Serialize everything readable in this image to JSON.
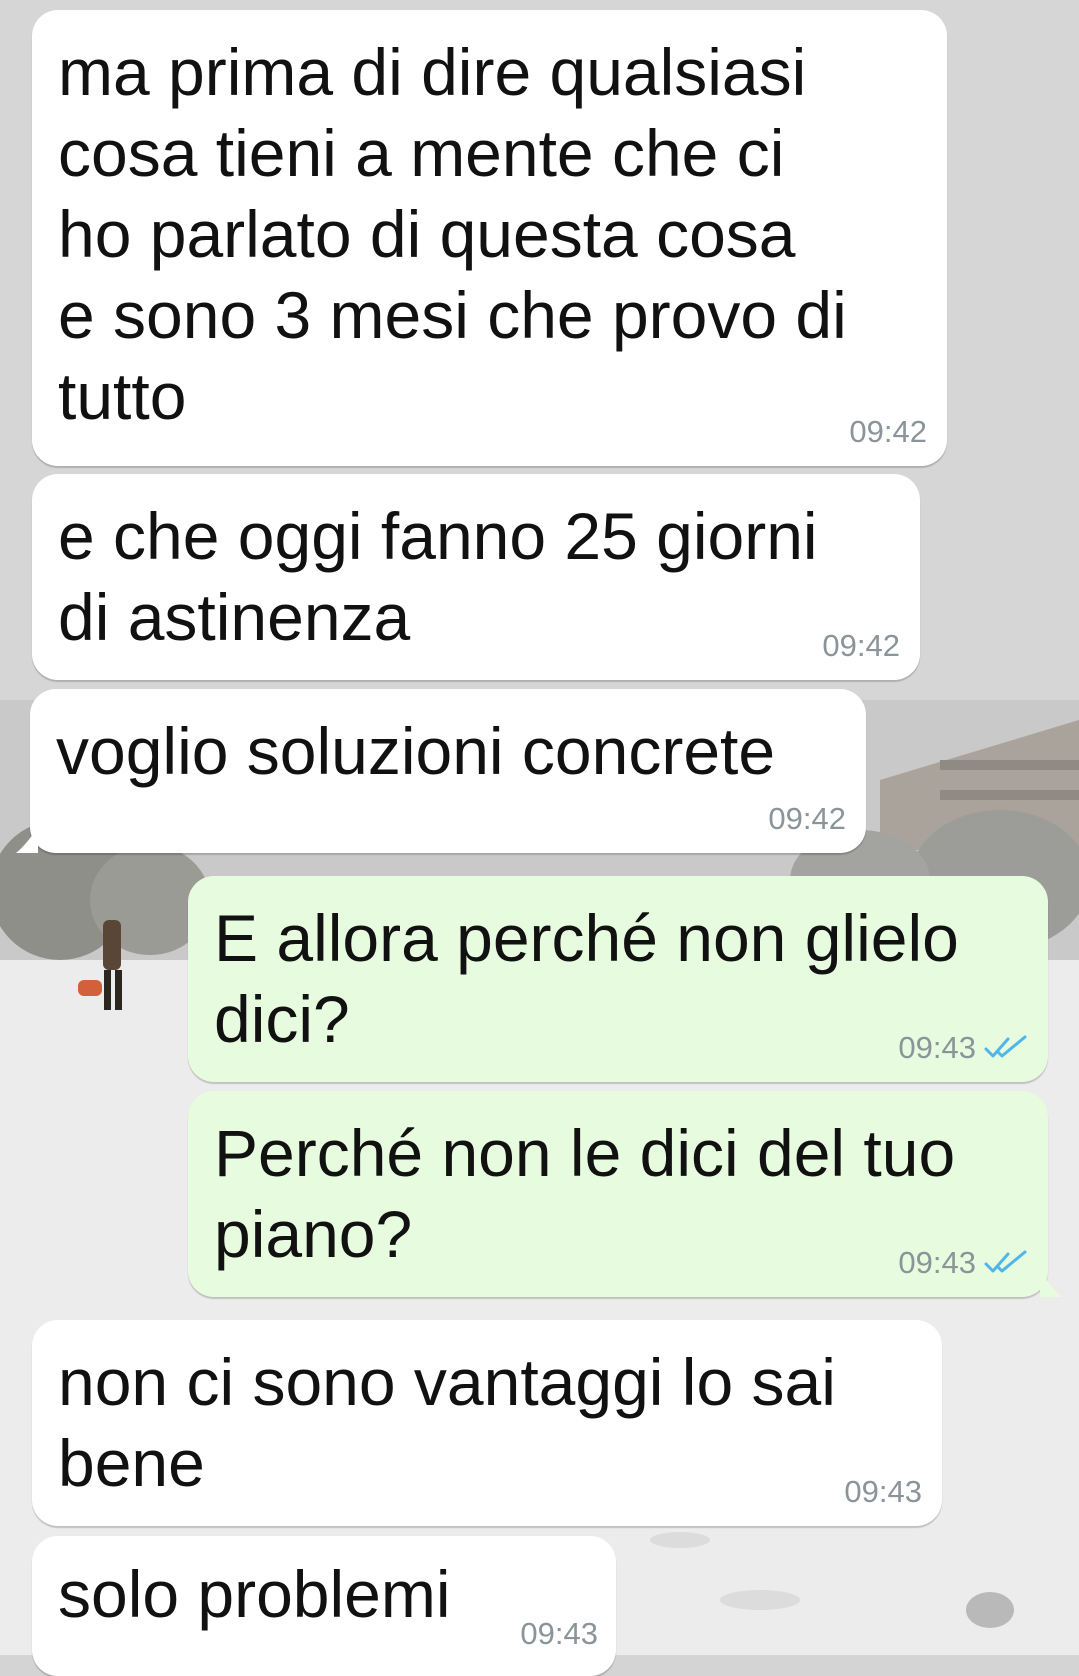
{
  "colors": {
    "incoming_bubble": "#ffffff",
    "outgoing_bubble": "#e7fbdf",
    "timestamp": "#8a9499",
    "read_ticks": "#4fb6ec"
  },
  "messages": [
    {
      "direction": "in",
      "lines": [
        "ma prima di dire qualsiasi",
        "cosa tieni a mente che ci",
        "ho parlato di questa cosa",
        "e sono 3 mesi che provo di",
        "tutto"
      ],
      "time": "09:42"
    },
    {
      "direction": "in",
      "lines": [
        "e che oggi fanno 25 giorni",
        "di astinenza"
      ],
      "time": "09:42"
    },
    {
      "direction": "in",
      "lines": [
        "voglio soluzioni concrete"
      ],
      "time": "09:42"
    },
    {
      "direction": "out",
      "lines": [
        "E allora perché non glielo",
        "dici?"
      ],
      "time": "09:43",
      "status_icon": "double-check-read-icon"
    },
    {
      "direction": "out",
      "lines": [
        "Perché non le dici del tuo",
        "piano?"
      ],
      "time": "09:43",
      "status_icon": "double-check-read-icon"
    },
    {
      "direction": "in",
      "lines": [
        "non ci sono vantaggi lo sai",
        "bene"
      ],
      "time": "09:43"
    },
    {
      "direction": "in",
      "lines": [
        "solo problemi"
      ],
      "time": "09:43"
    }
  ]
}
